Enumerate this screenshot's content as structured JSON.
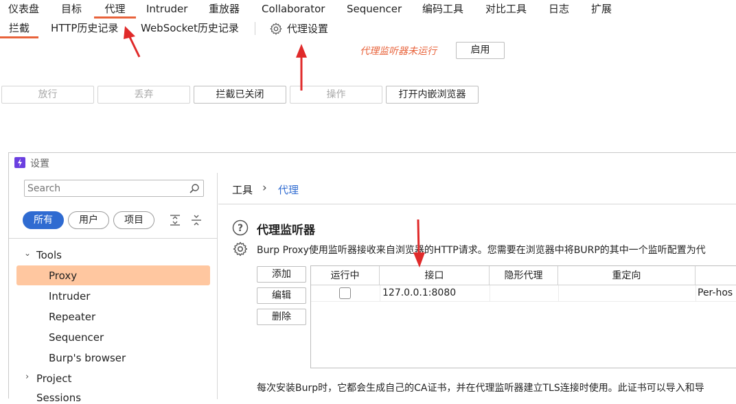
{
  "main_tabs": [
    "仪表盘",
    "目标",
    "代理",
    "Intruder",
    "重放器",
    "Collaborator",
    "Sequencer",
    "编码工具",
    "对比工具",
    "日志",
    "扩展"
  ],
  "sub_tabs": [
    "拦截",
    "HTTP历史记录",
    "WebSocket历史记录"
  ],
  "proxy_settings_label": "代理设置",
  "status": {
    "text": "代理监听器未运行",
    "enable_button": "启用"
  },
  "toolbar": [
    "放行",
    "丢弃",
    "拦截已关闭",
    "操作",
    "打开内嵌浏览器"
  ],
  "settings": {
    "title": "设置",
    "search_placeholder": "Search",
    "filters": [
      "所有",
      "用户",
      "项目"
    ],
    "tree": {
      "tools_label": "Tools",
      "tools_items": [
        "Proxy",
        "Intruder",
        "Repeater",
        "Sequencer",
        "Burp's browser"
      ],
      "project_label": "Project",
      "sessions_label": "Sessions"
    },
    "breadcrumb": {
      "root": "工具",
      "sep": "›",
      "current": "代理"
    },
    "section_title": "代理监听器",
    "section_desc": "Burp Proxy使用监听器接收来自浏览器的HTTP请求。您需要在浏览器中将BURP的其中一个监听配置为代",
    "buttons": [
      "添加",
      "编辑",
      "删除"
    ],
    "table": {
      "headers": [
        "运行中",
        "接口",
        "隐形代理",
        "重定向",
        ""
      ],
      "row": {
        "interface": "127.0.0.1:8080",
        "extra": "Per-hos"
      }
    },
    "footer_text": "每次安装Burp时，它都会生成自己的CA证书，并在代理监听器建立TLS连接时使用。此证书可以导入和导"
  },
  "colors": {
    "accent": "#e8623a",
    "selected": "#ffc7a0",
    "primary": "#2f6bd1",
    "arrow": "#e02a2a"
  }
}
